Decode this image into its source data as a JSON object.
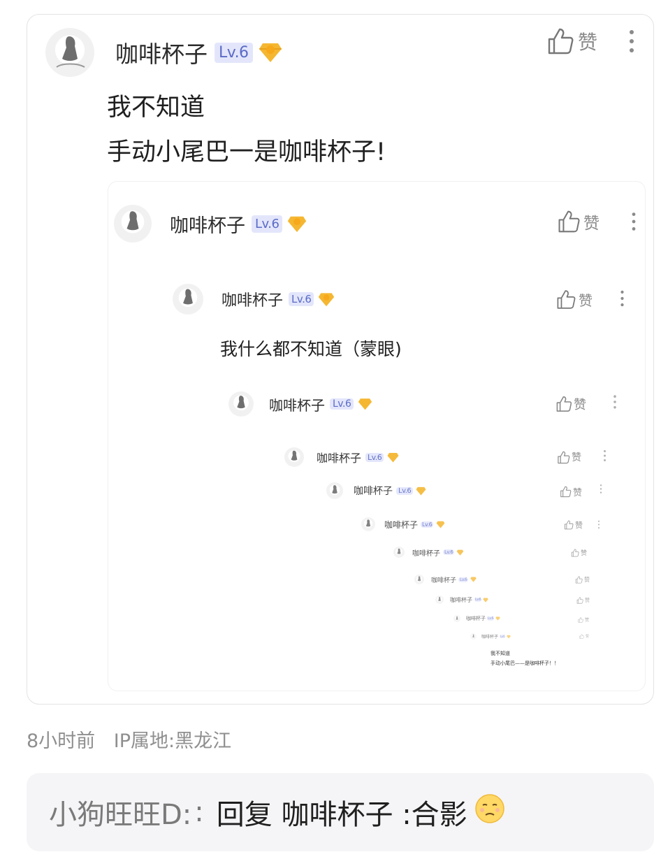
{
  "comment": {
    "user": "咖啡杯子",
    "level": "Lv.6",
    "like_label": "赞",
    "text_line1": "我不知道",
    "text_line2": "手动小尾巴一是咖啡杯子!",
    "nested": {
      "user": "咖啡杯子",
      "level": "Lv.6",
      "like_label": "赞",
      "reply": {
        "user": "咖啡杯子",
        "level": "Lv.6",
        "like_label": "赞",
        "text": "我什么都不知道（蒙眼)"
      },
      "echoes": [
        {
          "user": "咖啡杯子",
          "level": "Lv.6",
          "like_label": "赞"
        },
        {
          "user": "咖啡杯子",
          "level": "Lv.6",
          "like_label": "赞"
        },
        {
          "user": "咖啡杯子",
          "level": "Lv.6",
          "like_label": "赞"
        },
        {
          "user": "咖啡杯子",
          "level": "Lv.6",
          "like_label": "赞"
        },
        {
          "user": "咖啡杯子",
          "level": "Lv.6",
          "like_label": "赞"
        },
        {
          "user": "咖啡杯子",
          "level": "Lv.6",
          "like_label": "赞"
        },
        {
          "user": "咖啡杯子",
          "level": "Lv.6",
          "like_label": "赞"
        },
        {
          "user": "咖啡杯子",
          "level": "Lv.6",
          "like_label": "赞"
        },
        {
          "user": "咖啡杯子",
          "level": "Lv.6",
          "like_label": "赞"
        }
      ],
      "tiny_text_line1": "我不知道",
      "tiny_text_line2": "手动小尾巴——是咖啡杯子！！"
    }
  },
  "meta": {
    "time": "8小时前",
    "ip": "IP属地:黑龙江"
  },
  "reply": {
    "user": "小狗旺旺D:",
    "separator": ":",
    "text": "回复 咖啡杯子 :合影"
  },
  "icons": {
    "gem": "gem-icon",
    "like": "thumbs-up-icon",
    "more": "more-vertical-icon",
    "emoji": "sweating-face-emoji"
  },
  "colors": {
    "level_bg": "#e3e6fb",
    "level_text": "#5a6bc7",
    "gem": "#f5b731",
    "reply_bg": "#f5f5f7"
  }
}
